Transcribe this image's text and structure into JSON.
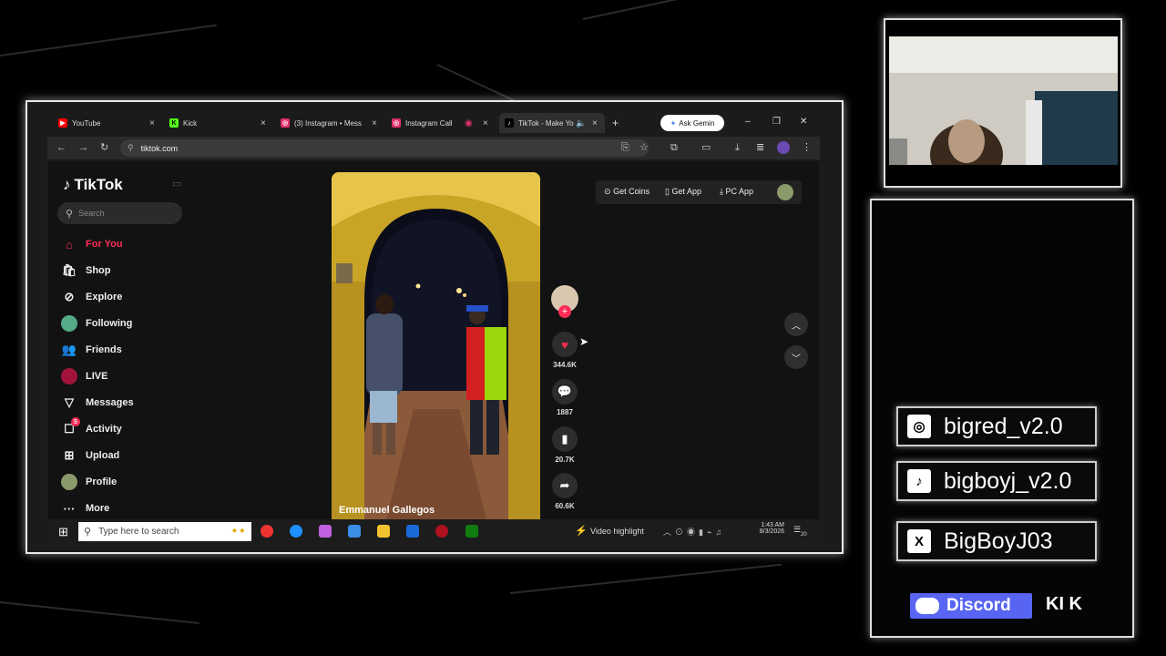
{
  "browser": {
    "tabs": [
      {
        "label": "YouTube",
        "favicon_color": "#ff0000",
        "active": false
      },
      {
        "label": "Kick",
        "favicon_color": "#53fc18",
        "active": false
      },
      {
        "label": "(3) Instagram • Mess",
        "favicon_color": "#e1306c",
        "active": false
      },
      {
        "label": "Instagram Call",
        "favicon_color": "#e1306c",
        "active": false
      },
      {
        "label": "TikTok - Make Yo",
        "favicon_color": "#ffffff",
        "active": true
      }
    ],
    "new_tab": "+",
    "ask_gemini": "Ask Gemin",
    "window_controls": [
      "–",
      "❐",
      "✕"
    ],
    "url": "tiktok.com"
  },
  "tiktok": {
    "logo": "TikTok",
    "search_placeholder": "Search",
    "nav": [
      {
        "label": "For You",
        "icon": "home-icon",
        "active": true
      },
      {
        "label": "Shop",
        "icon": "shop-icon"
      },
      {
        "label": "Explore",
        "icon": "compass-icon"
      },
      {
        "label": "Following",
        "icon": "following-avatar-icon"
      },
      {
        "label": "Friends",
        "icon": "friends-icon"
      },
      {
        "label": "LIVE",
        "icon": "live-icon"
      },
      {
        "label": "Messages",
        "icon": "messages-icon"
      },
      {
        "label": "Activity",
        "icon": "activity-icon",
        "badge": "5"
      },
      {
        "label": "Upload",
        "icon": "upload-icon"
      },
      {
        "label": "Profile",
        "icon": "profile-avatar-icon"
      },
      {
        "label": "More",
        "icon": "more-icon"
      }
    ],
    "video_author": "Emmanuel Gallegos",
    "actions": {
      "likes": "344.6K",
      "comments": "1887",
      "saves": "20.7K",
      "shares": "60.6K"
    },
    "top_buttons": [
      "Get Coins",
      "Get App",
      "PC App"
    ],
    "accent": "#fe2c55"
  },
  "taskbar": {
    "search_placeholder": "Type here to search",
    "notification": "Video highlight",
    "time": "1:43 AM",
    "date": "8/3/2026",
    "notif_count": "20"
  },
  "overlay": {
    "socials": [
      {
        "icon": "instagram-icon",
        "glyph": "◎",
        "handle": "bigred_v2.0"
      },
      {
        "icon": "tiktok-icon",
        "glyph": "♪",
        "handle": "bigboyj_v2.0"
      },
      {
        "icon": "x-icon",
        "glyph": "X",
        "handle": "BigBoyJ03"
      }
    ],
    "discord": "Discord",
    "kick": "KI K"
  }
}
